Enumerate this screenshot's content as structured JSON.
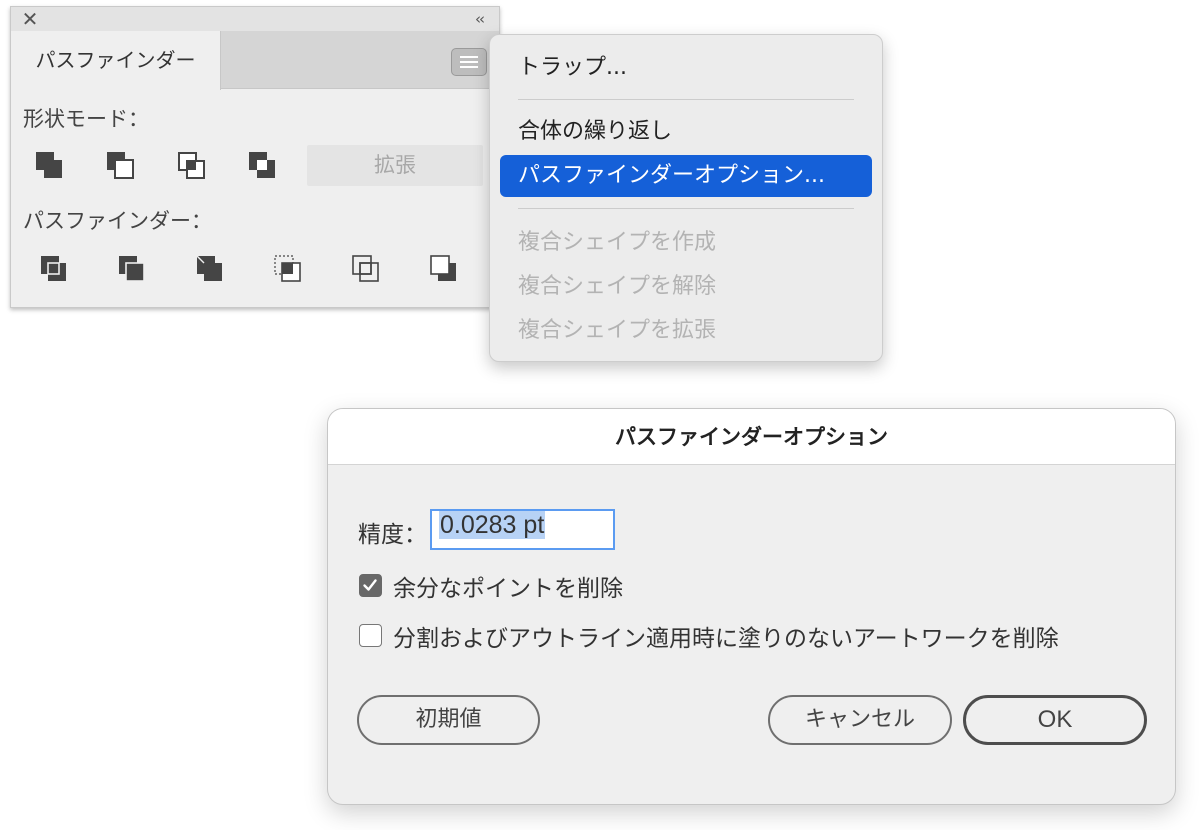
{
  "panel": {
    "close_glyph": "✕",
    "collapse_glyph": "‹‹",
    "tab_label": "パスファインダー",
    "menu_icon": "hamburger-menu-icon",
    "shape_modes_label": "形状モード：",
    "shape_modes": [
      "unite",
      "minus-front",
      "intersect",
      "exclude"
    ],
    "expand_label": "拡張",
    "pathfinders_label": "パスファインダー：",
    "pathfinders": [
      "divide",
      "trim",
      "merge",
      "crop",
      "outline",
      "minus-back"
    ]
  },
  "menu": {
    "trap": "トラップ...",
    "repeat_unite": "合体の繰り返し",
    "pathfinder_options": "パスファインダーオプション...",
    "make_compound_shape": "複合シェイプを作成",
    "release_compound_shape": "複合シェイプを解除",
    "expand_compound_shape": "複合シェイプを拡張",
    "highlight_color": "#1560d8"
  },
  "dialog": {
    "title": "パスファインダーオプション",
    "precision_label": "精度：",
    "precision_value": "0.0283 pt",
    "remove_redundant_points": {
      "label": "余分なポイントを削除",
      "checked": true
    },
    "divide_remove_unpainted": {
      "label": "分割およびアウトライン適用時に塗りのないアートワークを削除",
      "checked": false
    },
    "defaults_button": "初期値",
    "cancel_button": "キャンセル",
    "ok_button": "OK"
  }
}
